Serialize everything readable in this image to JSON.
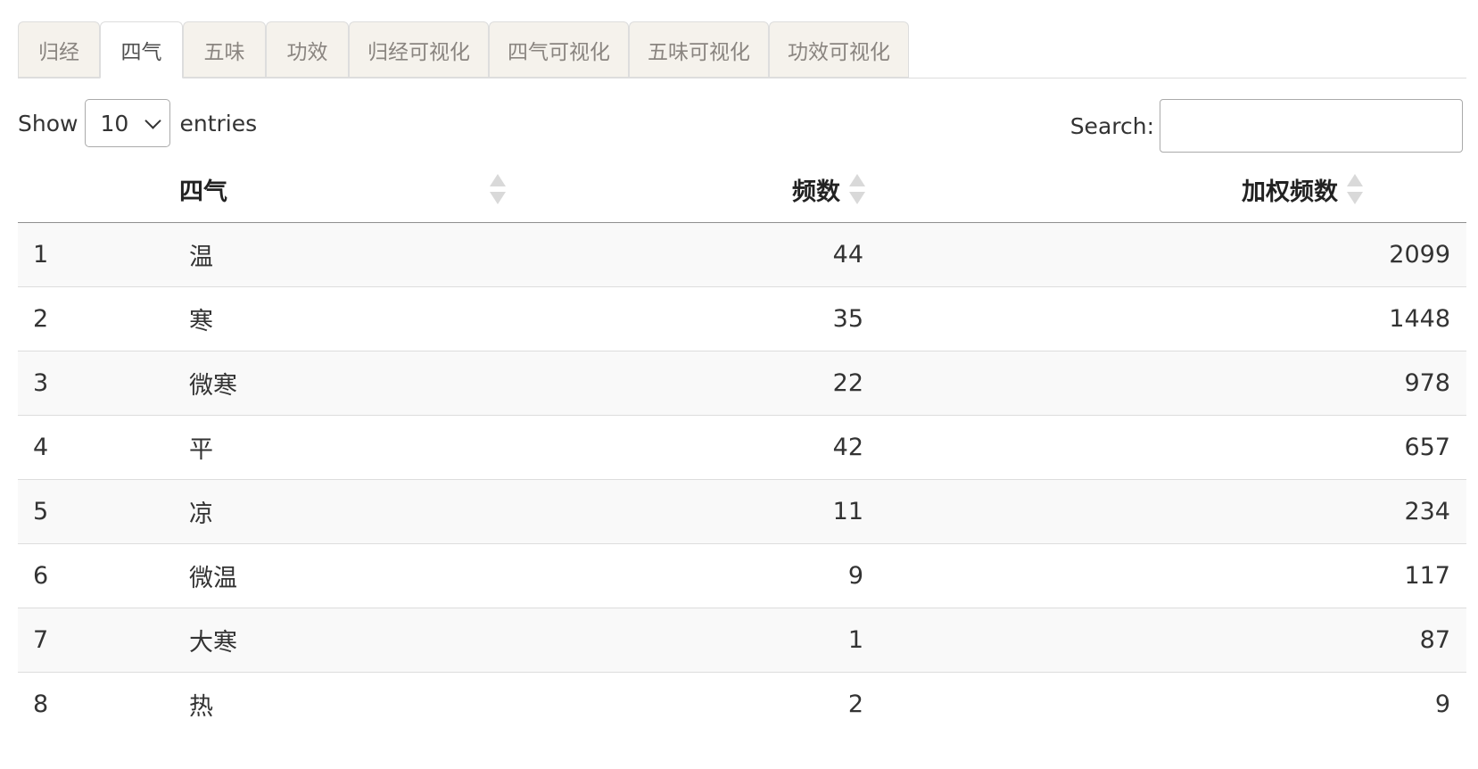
{
  "tabs": [
    "归经",
    "四气",
    "五味",
    "功效",
    "归经可视化",
    "四气可视化",
    "五味可视化",
    "功效可视化"
  ],
  "active_tab": "四气",
  "length_control": {
    "show": "Show",
    "value": "10",
    "entries": "entries"
  },
  "search": {
    "label": "Search:",
    "value": ""
  },
  "columns": {
    "index": "",
    "name": "四气",
    "freq": "频数",
    "weighted": "加权频数"
  },
  "rows": [
    {
      "index": "1",
      "name": "温",
      "freq": "44",
      "weighted": "2099"
    },
    {
      "index": "2",
      "name": "寒",
      "freq": "35",
      "weighted": "1448"
    },
    {
      "index": "3",
      "name": "微寒",
      "freq": "22",
      "weighted": "978"
    },
    {
      "index": "4",
      "name": "平",
      "freq": "42",
      "weighted": "657"
    },
    {
      "index": "5",
      "name": "凉",
      "freq": "11",
      "weighted": "234"
    },
    {
      "index": "6",
      "name": "微温",
      "freq": "9",
      "weighted": "117"
    },
    {
      "index": "7",
      "name": "大寒",
      "freq": "1",
      "weighted": "87"
    },
    {
      "index": "8",
      "name": "热",
      "freq": "2",
      "weighted": "9"
    }
  ],
  "icons": {
    "sort": "sort-both-icon",
    "select": "chevron-down-icon"
  },
  "colors": {
    "tab_bg": "#f5f2ec",
    "tab_text": "#8a8580",
    "stripe": "#f9f9f9",
    "border": "#dddddd"
  }
}
